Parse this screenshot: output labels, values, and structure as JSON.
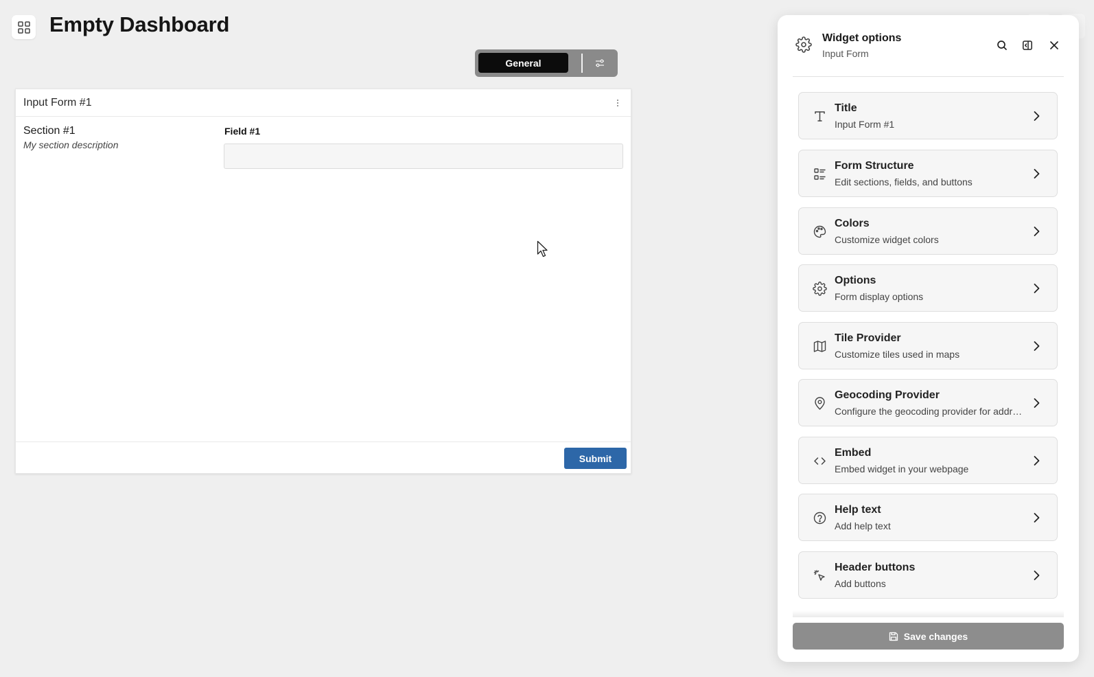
{
  "header": {
    "title": "Empty Dashboard",
    "apps_icon": "grid-icon"
  },
  "mode_toggle": {
    "active_label": "General",
    "settings_icon": "sliders-icon"
  },
  "widget": {
    "title": "Input Form #1",
    "section_title": "Section #1",
    "section_description": "My section description",
    "field_label": "Field #1",
    "field_value": "",
    "submit_label": "Submit",
    "accent_color": "#2d67a8"
  },
  "panel": {
    "title": "Widget options",
    "subtitle": "Input Form",
    "icons": [
      "gear-icon",
      "search-icon",
      "dock-icon",
      "close-icon"
    ],
    "options": [
      {
        "label": "Title",
        "description": "Input Form #1",
        "icon": "text-icon"
      },
      {
        "label": "Form Structure",
        "description": "Edit sections, fields, and buttons",
        "icon": "list-icon"
      },
      {
        "label": "Colors",
        "description": "Customize widget colors",
        "icon": "palette-icon"
      },
      {
        "label": "Options",
        "description": "Form display options",
        "icon": "gear-icon"
      },
      {
        "label": "Tile Provider",
        "description": "Customize tiles used in maps",
        "icon": "map-icon"
      },
      {
        "label": "Geocoding Provider",
        "description": "Configure the geocoding provider for address search",
        "icon": "map-pin-icon"
      },
      {
        "label": "Embed",
        "description": "Embed widget in your webpage",
        "icon": "code-icon"
      },
      {
        "label": "Help text",
        "description": "Add help text",
        "icon": "help-circle-icon"
      },
      {
        "label": "Header buttons",
        "description": "Add buttons",
        "icon": "pointer-click-icon"
      }
    ],
    "save_label": "Save changes",
    "save_color": "#8d8d8d"
  }
}
